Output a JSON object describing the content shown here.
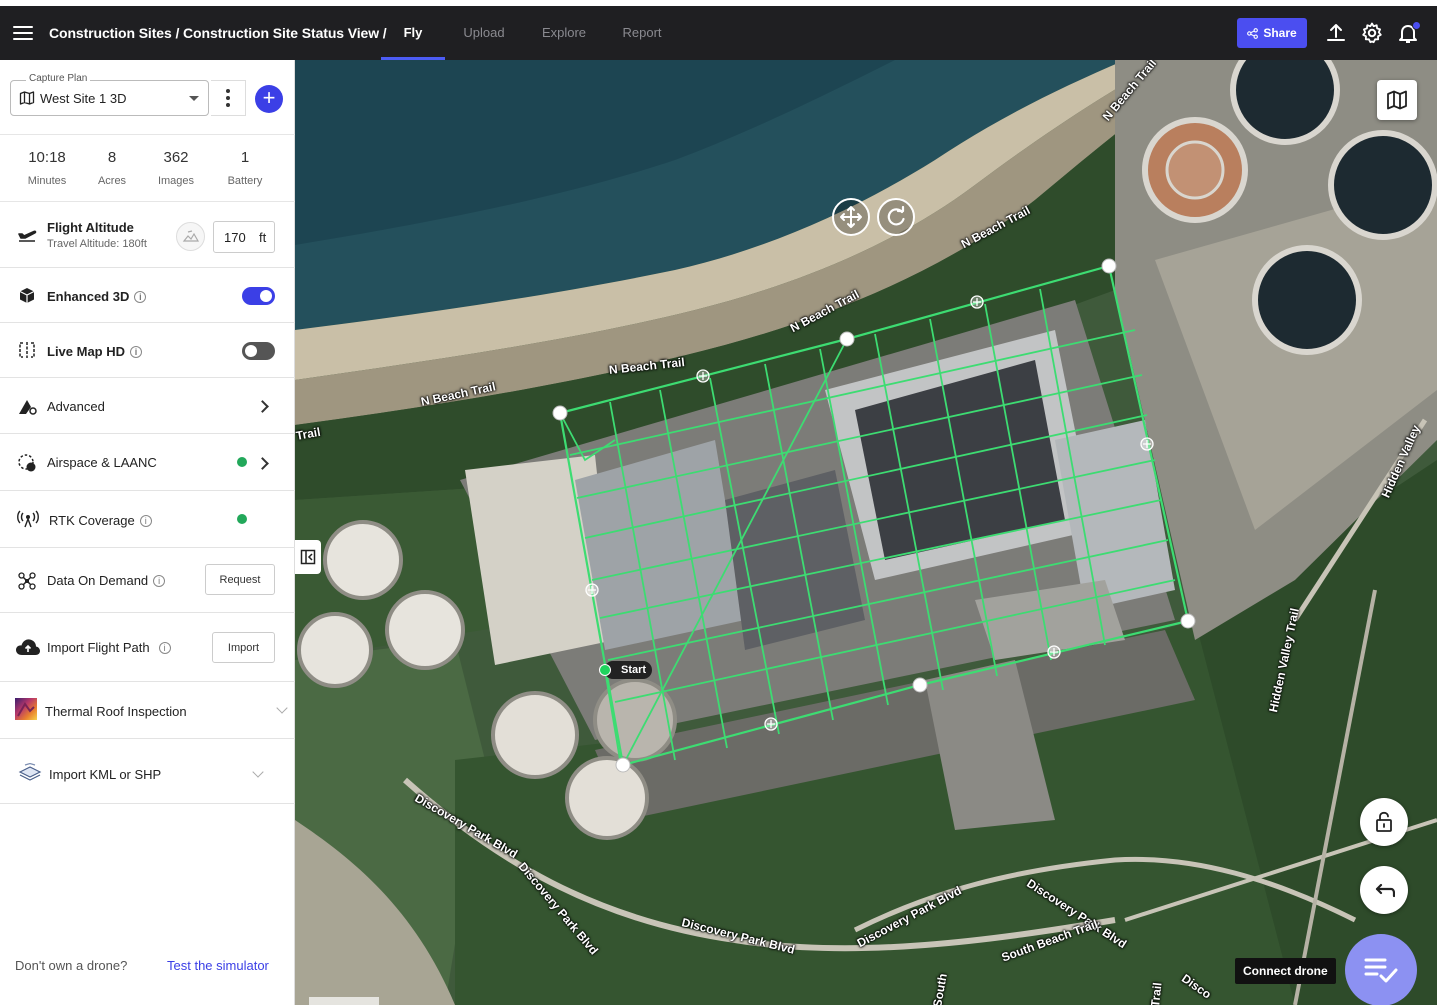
{
  "topbar": {
    "breadcrumb": "Construction Sites / Construction Site Status View /",
    "tabs": [
      {
        "label": "Fly",
        "active": true
      },
      {
        "label": "Upload",
        "active": false
      },
      {
        "label": "Explore",
        "active": false
      },
      {
        "label": "Report",
        "active": false
      }
    ],
    "share_label": "Share",
    "accent_color": "#4b4ef0"
  },
  "sidebar": {
    "capture_plan": {
      "legend": "Capture Plan",
      "value": "West Site 1 3D"
    },
    "stats": [
      {
        "value": "10:18",
        "label": "Minutes"
      },
      {
        "value": "8",
        "label": "Acres"
      },
      {
        "value": "362",
        "label": "Images"
      },
      {
        "value": "1",
        "label": "Battery"
      }
    ],
    "flight_altitude": {
      "label": "Flight Altitude",
      "sub": "Travel Altitude: 180ft",
      "value": "170",
      "unit": "ft"
    },
    "enhanced_3d": {
      "label": "Enhanced 3D",
      "info": "i",
      "enabled": true
    },
    "live_map_hd": {
      "label": "Live Map HD",
      "info": "i",
      "enabled": false
    },
    "advanced": {
      "label": "Advanced"
    },
    "airspace": {
      "label": "Airspace & LAANC",
      "status_color": "#22a85a"
    },
    "rtk": {
      "label": "RTK Coverage",
      "info": "i",
      "status_color": "#22a85a"
    },
    "data_on_demand": {
      "label": "Data On Demand",
      "info": "i",
      "button": "Request"
    },
    "import_flight_path": {
      "label": "Import Flight Path",
      "info": "i",
      "button": "Import"
    },
    "thermal": {
      "label": "Thermal Roof Inspection"
    },
    "import_kml": {
      "label": "Import KML or SHP"
    },
    "footer": {
      "prompt": "Don't own a drone?",
      "link": "Test the simulator"
    }
  },
  "map": {
    "road_labels": {
      "nbeach1": "N Beach Trail",
      "nbeach2": "N Beach Trail",
      "nbeach3": "N Beach Trail",
      "nbeach4": "N Beach Trail",
      "nbeach5": "N Beach Trail",
      "trail": "Trail",
      "hidden1": "Hidden Valley",
      "hidden2": "Hidden Valley Trail",
      "disc1": "Discovery Park Blvd",
      "disc2": "Discovery Park Blvd",
      "disc3": "Discovery Park Blvd",
      "disc4": "Discovery Park Blvd",
      "disc5": "Discovery Park Blvd",
      "southbeach": "South Beach Trail",
      "south": "South",
      "trail2": "Trail",
      "disco": "Disco"
    },
    "start_label": "Start",
    "connect_drone_label": "Connect drone"
  }
}
